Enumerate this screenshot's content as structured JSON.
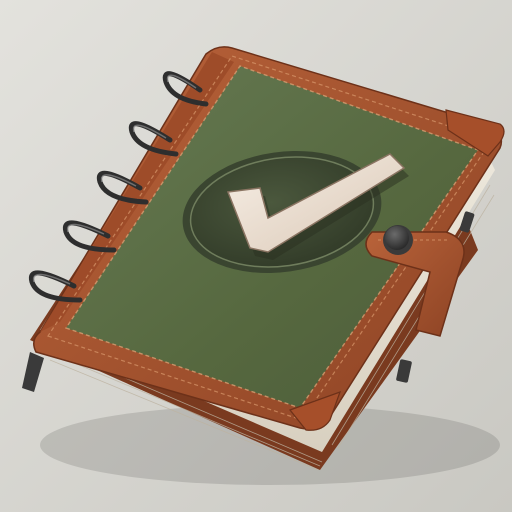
{
  "scene": {
    "subject": "binder-notebook",
    "icon": "checkmark-icon",
    "colors": {
      "background": "#d9d8d3",
      "cover_green": "#5b6e4a",
      "leather_brown": "#a9522e",
      "leather_dark": "#7a3a1f",
      "pages": "#efe9dc",
      "emblem_dark": "#3f4a33",
      "check_cream": "#efe3d4",
      "ring_metal": "#3a3a3a"
    }
  }
}
